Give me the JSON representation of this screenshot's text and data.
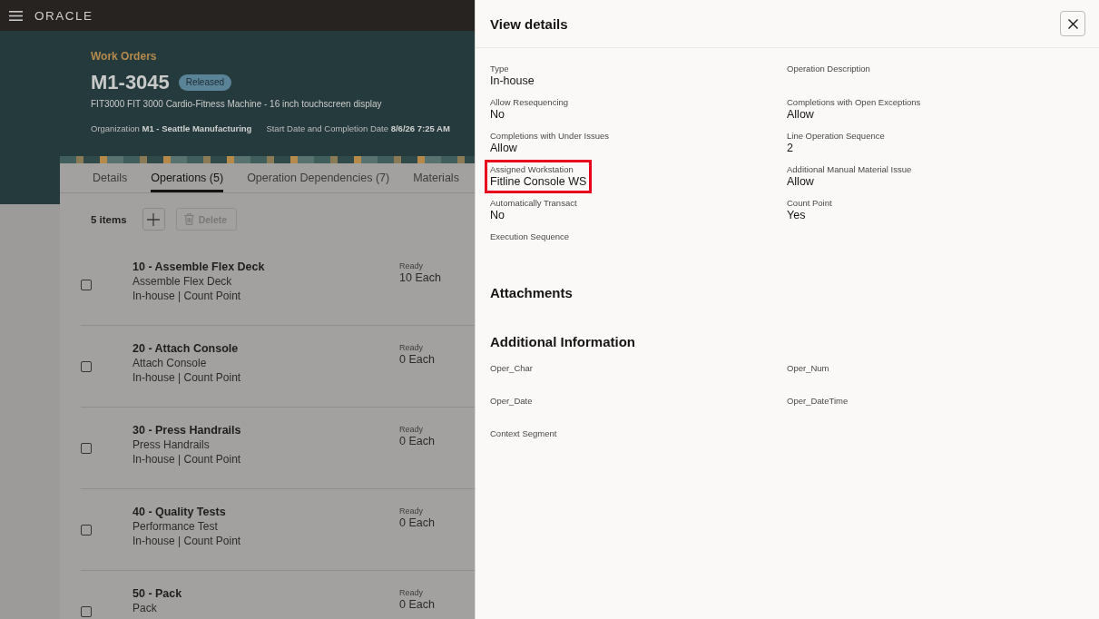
{
  "app_bar": {
    "brand": "ORACLE"
  },
  "header": {
    "breadcrumb": "Work Orders",
    "title": "M1-3045",
    "status": "Released",
    "description": "FIT3000 FIT 3000 Cardio-Fitness Machine - 16 inch touchscreen display",
    "meta": [
      {
        "label": "Organization",
        "value": "M1 - Seattle Manufacturing"
      },
      {
        "label": "Start Date and Completion Date",
        "value": "8/6/26 7:25 AM"
      }
    ]
  },
  "tabs": [
    {
      "label": "Details",
      "selected": false
    },
    {
      "label": "Operations (5)",
      "selected": true
    },
    {
      "label": "Operation Dependencies (7)",
      "selected": false
    },
    {
      "label": "Materials",
      "selected": false
    }
  ],
  "toolbar": {
    "count": "5 items",
    "buttons": [
      {
        "kind": "add",
        "disabled": false
      },
      {
        "kind": "delete",
        "label": "Delete",
        "disabled": true
      }
    ]
  },
  "operations": [
    {
      "title": "10 - Assemble Flex Deck",
      "description": "Assemble Flex Deck",
      "attributes": "In-house | Count Point",
      "status": "Ready",
      "quantity": "10 Each",
      "checked": false
    },
    {
      "title": "20 - Attach Console",
      "description": "Attach Console",
      "attributes": "In-house | Count Point",
      "status": "Ready",
      "quantity": "0 Each",
      "checked": false
    },
    {
      "title": "30 - Press Handrails",
      "description": "Press Handrails",
      "attributes": "In-house | Count Point",
      "status": "Ready",
      "quantity": "0 Each",
      "checked": false
    },
    {
      "title": "40 - Quality Tests",
      "description": "Performance Test",
      "attributes": "In-house | Count Point",
      "status": "Ready",
      "quantity": "0 Each",
      "checked": false
    },
    {
      "title": "50 - Pack",
      "description": "Pack",
      "status": "Ready",
      "quantity": "0 Each",
      "checked": false
    }
  ],
  "details_panel": {
    "title": "View details",
    "fields": [
      {
        "label": "Type",
        "value": "In-house",
        "highlighted": false
      },
      {
        "label": "Operation Description",
        "highlighted": false
      },
      {
        "label": "Allow Resequencing",
        "value": "No",
        "highlighted": false
      },
      {
        "label": "Completions with Open Exceptions",
        "value": "Allow",
        "highlighted": false
      },
      {
        "label": "Completions with Under Issues",
        "value": "Allow",
        "highlighted": false
      },
      {
        "label": "Line Operation Sequence",
        "value": "2",
        "highlighted": false
      },
      {
        "label": "Assigned Workstation",
        "value": "Fitline Console WS",
        "highlighted": true
      },
      {
        "label": "Additional Manual Material Issue",
        "value": "Allow",
        "highlighted": false
      },
      {
        "label": "Automatically Transact",
        "value": "No",
        "highlighted": false
      },
      {
        "label": "Count Point",
        "value": "Yes",
        "highlighted": false
      },
      {
        "label": "Execution Sequence",
        "highlighted": false
      }
    ],
    "sections": [
      {
        "title": "Attachments"
      },
      {
        "title": "Additional Information",
        "fields": [
          {
            "label": "Oper_Char"
          },
          {
            "label": "Oper_Num"
          },
          {
            "label": "Oper_Date"
          },
          {
            "label": "Oper_DateTime"
          },
          {
            "label": "Context Segment"
          }
        ]
      }
    ]
  }
}
